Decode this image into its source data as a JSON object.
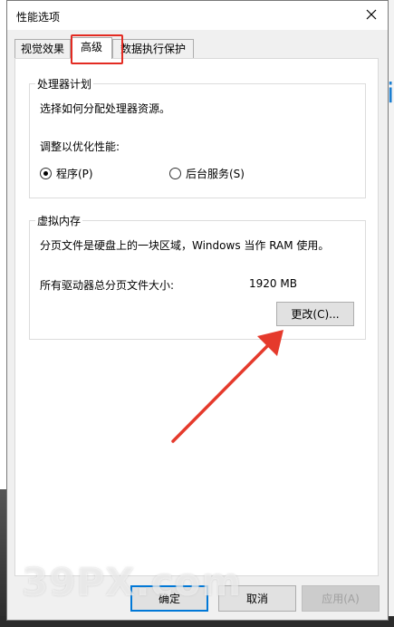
{
  "window": {
    "title": "性能选项"
  },
  "tabs": [
    {
      "label": "视觉效果"
    },
    {
      "label": "高级"
    },
    {
      "label": "数据执行保护"
    }
  ],
  "processor": {
    "group_title": "处理器计划",
    "description": "选择如何分配处理器资源。",
    "adjust_label": "调整以优化性能:",
    "option_programs": "程序(P)",
    "option_background": "后台服务(S)",
    "selected": "程序(P)"
  },
  "virtual_memory": {
    "group_title": "虚拟内存",
    "description": "分页文件是硬盘上的一块区域，Windows 当作 RAM 使用。",
    "total_label": "所有驱动器总分页文件大小:",
    "total_value": "1920 MB",
    "change_button": "更改(C)..."
  },
  "footer": {
    "ok": "确定",
    "cancel": "取消",
    "apply": "应用(A)"
  },
  "watermark": "39PX.com",
  "colors": {
    "highlight": "#e32b22",
    "arrow": "#e53a2c",
    "default_button_border": "#0078d7"
  }
}
